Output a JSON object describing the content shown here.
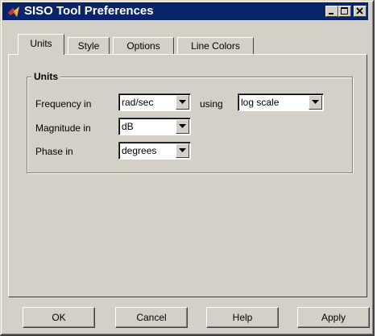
{
  "window": {
    "title": "SISO Tool Preferences",
    "icon": "matlab-icon"
  },
  "tabs": [
    {
      "label": "Units",
      "active": true
    },
    {
      "label": "Style",
      "active": false
    },
    {
      "label": "Options",
      "active": false
    },
    {
      "label": "Line Colors",
      "active": false
    }
  ],
  "units_group": {
    "title": "Units",
    "frequency": {
      "label": "Frequency in",
      "value": "rad/sec"
    },
    "using": {
      "label": "using",
      "value": "log scale"
    },
    "magnitude": {
      "label": "Magnitude in",
      "value": "dB"
    },
    "phase": {
      "label": "Phase in",
      "value": "degrees"
    }
  },
  "buttons": {
    "ok": "OK",
    "cancel": "Cancel",
    "help": "Help",
    "apply": "Apply"
  },
  "colors": {
    "titlebar": "#0a246a",
    "face": "#d4d0c8"
  }
}
